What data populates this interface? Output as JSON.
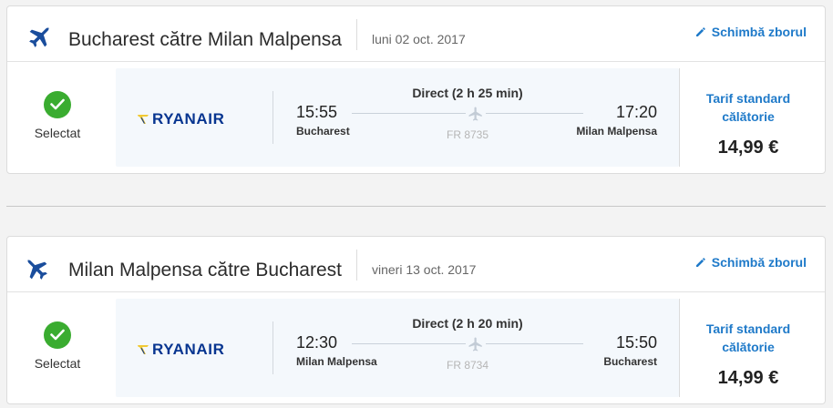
{
  "flights": [
    {
      "route": "Bucharest către Milan Malpensa",
      "date": "luni 02 oct. 2017",
      "change_label": "Schimbă zborul",
      "selected_label": "Selectat",
      "airline": "RYANAIR",
      "dep_time": "15:55",
      "dep_city": "Bucharest",
      "arr_time": "17:20",
      "arr_city": "Milan Malpensa",
      "duration": "Direct (2 h 25 min)",
      "flight_number": "FR 8735",
      "fare_label": "Tarif standard călătorie",
      "price": "14,99 €"
    },
    {
      "route": "Milan Malpensa către Bucharest",
      "date": "vineri 13 oct. 2017",
      "change_label": "Schimbă zborul",
      "selected_label": "Selectat",
      "airline": "RYANAIR",
      "dep_time": "12:30",
      "dep_city": "Milan Malpensa",
      "arr_time": "15:50",
      "arr_city": "Bucharest",
      "duration": "Direct (2 h 20 min)",
      "flight_number": "FR 8734",
      "fare_label": "Tarif standard călătorie",
      "price": "14,99 €"
    }
  ],
  "colors": {
    "accent": "#1f7ac9",
    "check": "#3aac30",
    "brand": "#073590",
    "plane_icon": "#1a4d9c"
  },
  "icons": {
    "header": "airplane-icon",
    "edit": "pencil-icon",
    "selected": "check-circle-icon",
    "route": "airplane-small-icon"
  }
}
